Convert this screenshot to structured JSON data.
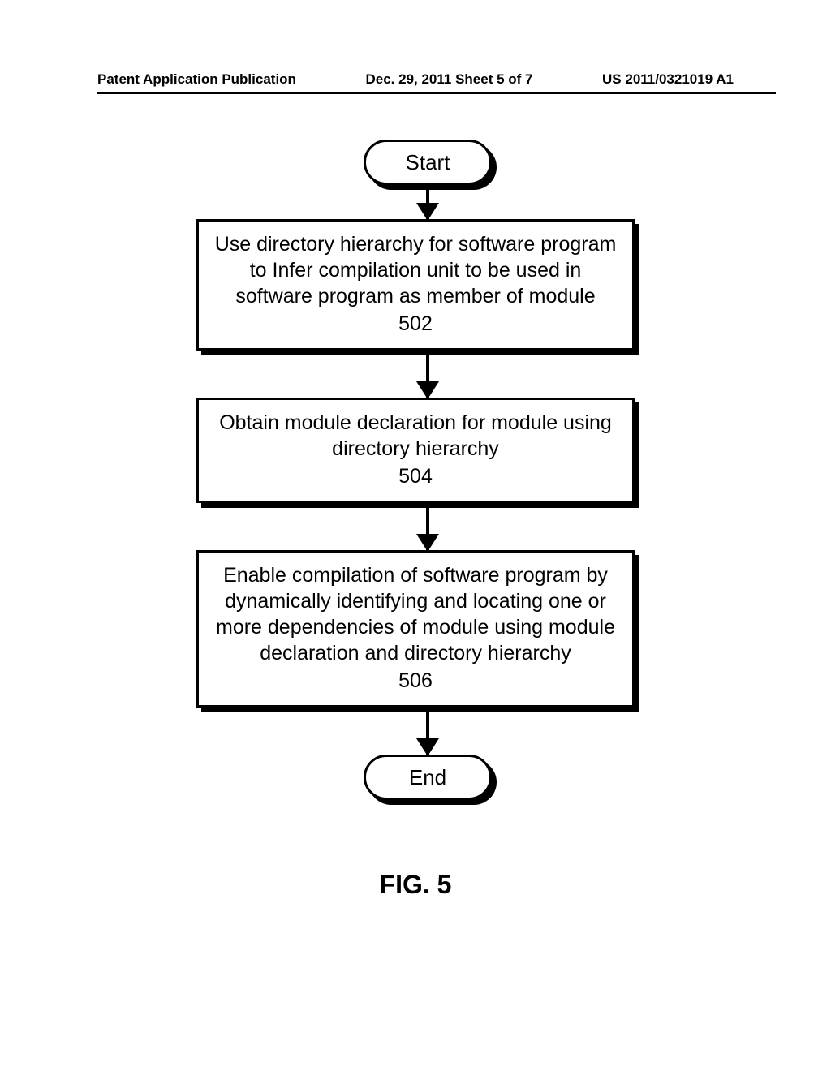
{
  "header": {
    "left": "Patent Application Publication",
    "center": "Dec. 29, 2011  Sheet 5 of 7",
    "right": "US 2011/0321019 A1"
  },
  "flowchart": {
    "start": "Start",
    "end": "End",
    "steps": [
      {
        "text": "Use directory hierarchy for software program to Infer compilation unit to be used in software program as member of module",
        "ref": "502"
      },
      {
        "text": "Obtain module declaration for module using directory hierarchy",
        "ref": "504"
      },
      {
        "text": "Enable compilation of software program by dynamically identifying and locating one or more dependencies of module using module declaration and directory hierarchy",
        "ref": "506"
      }
    ]
  },
  "figure_label": "FIG. 5"
}
